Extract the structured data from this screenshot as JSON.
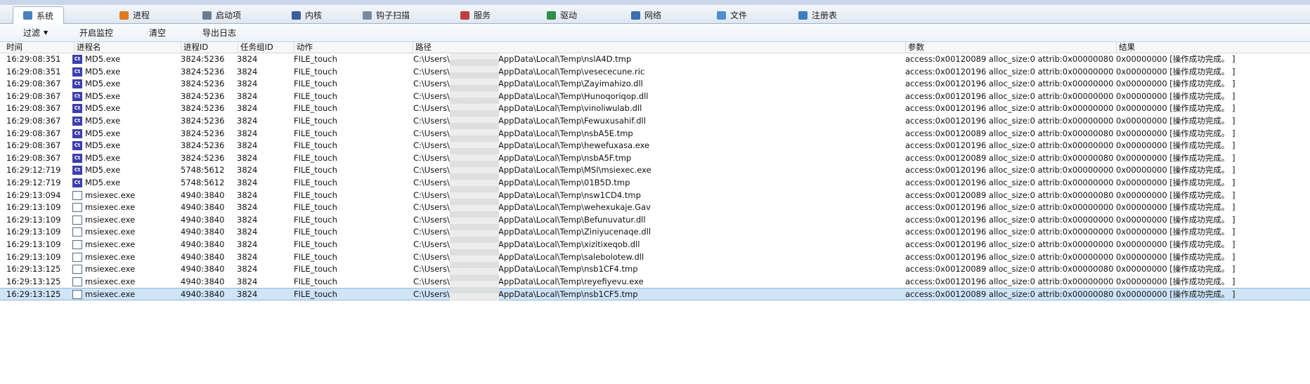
{
  "tabs": [
    {
      "label": "系统",
      "icon": "monitor-icon",
      "color": "#4a7fc1",
      "active": true
    },
    {
      "label": "进程",
      "icon": "windows-icon",
      "color": "#e07a20"
    },
    {
      "label": "启动项",
      "icon": "gear-icon",
      "color": "#6b7c8f"
    },
    {
      "label": "内核",
      "icon": "hammer-icon",
      "color": "#3a5fa0"
    },
    {
      "label": "钩子扫描",
      "icon": "hook-icon",
      "color": "#7a8aa0"
    },
    {
      "label": "服务",
      "icon": "service-icon",
      "color": "#c04040"
    },
    {
      "label": "驱动",
      "icon": "driver-icon",
      "color": "#2f8f4a"
    },
    {
      "label": "网络",
      "icon": "network-icon",
      "color": "#3a6fb0"
    },
    {
      "label": "文件",
      "icon": "file-icon",
      "color": "#4f8fd0"
    },
    {
      "label": "注册表",
      "icon": "registry-icon",
      "color": "#3a7fc0"
    }
  ],
  "toolbar": {
    "filter": "过滤",
    "monitor": "开启监控",
    "clear": "清空",
    "export": "导出日志"
  },
  "columns": [
    "时间",
    "进程名",
    "进程ID",
    "任务组ID",
    "动作",
    "路径",
    "参数",
    "结果"
  ],
  "rows": [
    {
      "time": "16:29:08:351",
      "proc": "MD5.exe",
      "icon": "md5",
      "pid": "3824:5236",
      "gid": "3824",
      "action": "FILE_touch",
      "p1": "C:\\Users\\",
      "p2": "AppData\\Local\\Temp\\nslA4D.tmp",
      "param": "access:0x00120089 alloc_size:0 attrib:0x00000080...",
      "result": "0x00000000 [操作成功完成。 ]"
    },
    {
      "time": "16:29:08:351",
      "proc": "MD5.exe",
      "icon": "md5",
      "pid": "3824:5236",
      "gid": "3824",
      "action": "FILE_touch",
      "p1": "C:\\Users\\",
      "p2": "AppData\\Local\\Temp\\vesececune.ric",
      "param": "access:0x00120196 alloc_size:0 attrib:0x00000000...",
      "result": "0x00000000 [操作成功完成。 ]"
    },
    {
      "time": "16:29:08:367",
      "proc": "MD5.exe",
      "icon": "md5",
      "pid": "3824:5236",
      "gid": "3824",
      "action": "FILE_touch",
      "p1": "C:\\Users\\",
      "p2": "AppData\\Local\\Temp\\Zayimahizo.dll",
      "param": "access:0x00120196 alloc_size:0 attrib:0x00000000...",
      "result": "0x00000000 [操作成功完成。 ]"
    },
    {
      "time": "16:29:08:367",
      "proc": "MD5.exe",
      "icon": "md5",
      "pid": "3824:5236",
      "gid": "3824",
      "action": "FILE_touch",
      "p1": "C:\\Users\\",
      "p2": "AppData\\Local\\Temp\\Hunoqoriqop.dll",
      "param": "access:0x00120196 alloc_size:0 attrib:0x00000000...",
      "result": "0x00000000 [操作成功完成。 ]"
    },
    {
      "time": "16:29:08:367",
      "proc": "MD5.exe",
      "icon": "md5",
      "pid": "3824:5236",
      "gid": "3824",
      "action": "FILE_touch",
      "p1": "C:\\Users\\",
      "p2": "AppData\\Local\\Temp\\vinoliwulab.dll",
      "param": "access:0x00120196 alloc_size:0 attrib:0x00000000...",
      "result": "0x00000000 [操作成功完成。 ]"
    },
    {
      "time": "16:29:08:367",
      "proc": "MD5.exe",
      "icon": "md5",
      "pid": "3824:5236",
      "gid": "3824",
      "action": "FILE_touch",
      "p1": "C:\\Users\\",
      "p2": "AppData\\Local\\Temp\\Fewuxusahif.dll",
      "param": "access:0x00120196 alloc_size:0 attrib:0x00000000...",
      "result": "0x00000000 [操作成功完成。 ]"
    },
    {
      "time": "16:29:08:367",
      "proc": "MD5.exe",
      "icon": "md5",
      "pid": "3824:5236",
      "gid": "3824",
      "action": "FILE_touch",
      "p1": "C:\\Users\\",
      "p2": "AppData\\Local\\Temp\\nsbA5E.tmp",
      "param": "access:0x00120089 alloc_size:0 attrib:0x00000080...",
      "result": "0x00000000 [操作成功完成。 ]"
    },
    {
      "time": "16:29:08:367",
      "proc": "MD5.exe",
      "icon": "md5",
      "pid": "3824:5236",
      "gid": "3824",
      "action": "FILE_touch",
      "p1": "C:\\Users\\",
      "p2": "AppData\\Local\\Temp\\hewefuxasa.exe",
      "param": "access:0x00120196 alloc_size:0 attrib:0x00000000...",
      "result": "0x00000000 [操作成功完成。 ]"
    },
    {
      "time": "16:29:08:367",
      "proc": "MD5.exe",
      "icon": "md5",
      "pid": "3824:5236",
      "gid": "3824",
      "action": "FILE_touch",
      "p1": "C:\\Users\\",
      "p2": "AppData\\Local\\Temp\\nsbA5F.tmp",
      "param": "access:0x00120089 alloc_size:0 attrib:0x00000080...",
      "result": "0x00000000 [操作成功完成。 ]"
    },
    {
      "time": "16:29:12:719",
      "proc": "MD5.exe",
      "icon": "md5",
      "pid": "5748:5612",
      "gid": "3824",
      "action": "FILE_touch",
      "p1": "C:\\Users\\",
      "p2": "AppData\\Local\\Temp\\MSI\\msiexec.exe",
      "param": "access:0x00120196 alloc_size:0 attrib:0x00000000...",
      "result": "0x00000000 [操作成功完成。 ]"
    },
    {
      "time": "16:29:12:719",
      "proc": "MD5.exe",
      "icon": "md5",
      "pid": "5748:5612",
      "gid": "3824",
      "action": "FILE_touch",
      "p1": "C:\\Users\\",
      "p2": "AppData\\Local\\Temp\\01B5D.tmp",
      "param": "access:0x00120196 alloc_size:0 attrib:0x00000000...",
      "result": "0x00000000 [操作成功完成。 ]"
    },
    {
      "time": "16:29:13:094",
      "proc": "msiexec.exe",
      "icon": "msi",
      "pid": "4940:3840",
      "gid": "3824",
      "action": "FILE_touch",
      "p1": "C:\\Users\\",
      "p2": "AppData\\Local\\Temp\\nsw1CD4.tmp",
      "param": "access:0x00120089 alloc_size:0 attrib:0x00000080...",
      "result": "0x00000000 [操作成功完成。 ]"
    },
    {
      "time": "16:29:13:109",
      "proc": "msiexec.exe",
      "icon": "msi",
      "pid": "4940:3840",
      "gid": "3824",
      "action": "FILE_touch",
      "p1": "C:\\Users\\",
      "p2": "AppData\\Local\\Temp\\wehexukaje.Gav",
      "param": "access:0x00120196 alloc_size:0 attrib:0x00000000...",
      "result": "0x00000000 [操作成功完成。 ]"
    },
    {
      "time": "16:29:13:109",
      "proc": "msiexec.exe",
      "icon": "msi",
      "pid": "4940:3840",
      "gid": "3824",
      "action": "FILE_touch",
      "p1": "C:\\Users\\",
      "p2": "AppData\\Local\\Temp\\Befunuvatur.dll",
      "param": "access:0x00120196 alloc_size:0 attrib:0x00000000...",
      "result": "0x00000000 [操作成功完成。 ]"
    },
    {
      "time": "16:29:13:109",
      "proc": "msiexec.exe",
      "icon": "msi",
      "pid": "4940:3840",
      "gid": "3824",
      "action": "FILE_touch",
      "p1": "C:\\Users\\",
      "p2": "AppData\\Local\\Temp\\Ziniyucenaqe.dll",
      "param": "access:0x00120196 alloc_size:0 attrib:0x00000000...",
      "result": "0x00000000 [操作成功完成。 ]"
    },
    {
      "time": "16:29:13:109",
      "proc": "msiexec.exe",
      "icon": "msi",
      "pid": "4940:3840",
      "gid": "3824",
      "action": "FILE_touch",
      "p1": "C:\\Users\\",
      "p2": "AppData\\Local\\Temp\\xizitixeqob.dll",
      "param": "access:0x00120196 alloc_size:0 attrib:0x00000000...",
      "result": "0x00000000 [操作成功完成。 ]"
    },
    {
      "time": "16:29:13:109",
      "proc": "msiexec.exe",
      "icon": "msi",
      "pid": "4940:3840",
      "gid": "3824",
      "action": "FILE_touch",
      "p1": "C:\\Users\\",
      "p2": "AppData\\Local\\Temp\\salebolotew.dll",
      "param": "access:0x00120196 alloc_size:0 attrib:0x00000000...",
      "result": "0x00000000 [操作成功完成。 ]"
    },
    {
      "time": "16:29:13:125",
      "proc": "msiexec.exe",
      "icon": "msi",
      "pid": "4940:3840",
      "gid": "3824",
      "action": "FILE_touch",
      "p1": "C:\\Users\\",
      "p2": "AppData\\Local\\Temp\\nsb1CF4.tmp",
      "param": "access:0x00120089 alloc_size:0 attrib:0x00000080...",
      "result": "0x00000000 [操作成功完成。 ]"
    },
    {
      "time": "16:29:13:125",
      "proc": "msiexec.exe",
      "icon": "msi",
      "pid": "4940:3840",
      "gid": "3824",
      "action": "FILE_touch",
      "p1": "C:\\Users\\",
      "p2": "AppData\\Local\\Temp\\reyefiyevu.exe",
      "param": "access:0x00120196 alloc_size:0 attrib:0x00000000...",
      "result": "0x00000000 [操作成功完成。 ]"
    },
    {
      "time": "16:29:13:125",
      "proc": "msiexec.exe",
      "icon": "msi",
      "pid": "4940:3840",
      "gid": "3824",
      "action": "FILE_touch",
      "p1": "C:\\Users\\",
      "p2": "AppData\\Local\\Temp\\nsb1CF5.tmp",
      "param": "access:0x00120089 alloc_size:0 attrib:0x00000080...",
      "result": "0x00000000 [操作成功完成。 ]",
      "selected": true
    }
  ]
}
